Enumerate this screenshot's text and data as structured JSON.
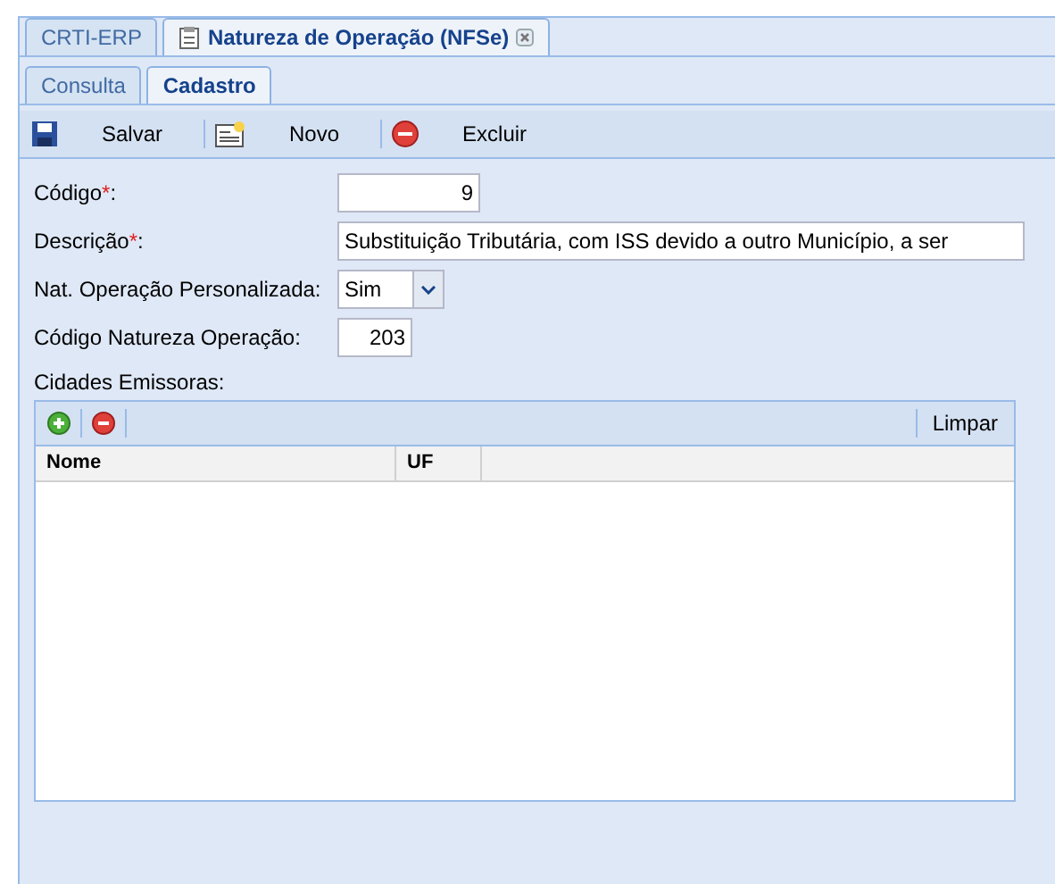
{
  "main_tabs": [
    {
      "label": "CRTI-ERP",
      "selected": false,
      "closable": false
    },
    {
      "label": "Natureza de Operação (NFSe)",
      "selected": true,
      "closable": true
    }
  ],
  "sub_tabs": [
    {
      "label": "Consulta",
      "selected": false
    },
    {
      "label": "Cadastro",
      "selected": true
    }
  ],
  "toolbar": [
    {
      "kind": "save",
      "label": "Salvar"
    },
    {
      "kind": "new",
      "label": "Novo"
    },
    {
      "kind": "delete",
      "label": "Excluir"
    }
  ],
  "fields": [
    {
      "kind": "number",
      "label": "Código",
      "required_mark": "*",
      "label_end": ":",
      "value": "9"
    },
    {
      "kind": "text",
      "label": "Descrição",
      "required_mark": "*",
      "label_end": ":",
      "value": "Substituição Tributária, com ISS devido a outro Município, a ser"
    },
    {
      "kind": "select",
      "label": "Nat. Operação Personalizada:",
      "value": "Sim"
    },
    {
      "kind": "number",
      "label": "Código Natureza Operação:",
      "value": "203"
    }
  ],
  "cities": {
    "label": "Cidades Emissoras:",
    "clear_button": "Limpar",
    "columns": [
      "Nome",
      "UF"
    ]
  }
}
